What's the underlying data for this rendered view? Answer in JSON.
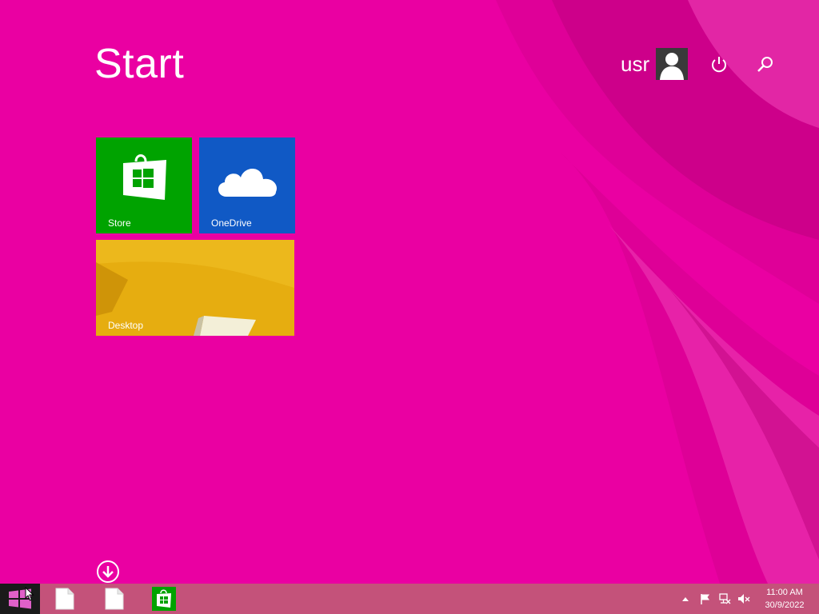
{
  "start": {
    "title": "Start"
  },
  "user": {
    "name": "usr"
  },
  "tiles": [
    {
      "label": "Store",
      "color": "#00a300",
      "icon": "store-bag-icon"
    },
    {
      "label": "OneDrive",
      "color": "#1059c5",
      "icon": "cloud-icon"
    },
    {
      "label": "Desktop",
      "color": "#e6ad10",
      "icon": "desktop-wallpaper"
    }
  ],
  "taskbar": {
    "items": [
      {
        "name": "start-button",
        "icon": "windows-logo-icon"
      },
      {
        "name": "document-1",
        "icon": "document-icon"
      },
      {
        "name": "document-2",
        "icon": "document-icon"
      },
      {
        "name": "store-app",
        "icon": "store-bag-icon"
      }
    ],
    "tray": [
      "show-hidden-icons-arrow",
      "action-center-flag-icon",
      "network-icon",
      "volume-muted-icon"
    ],
    "time": "11:00 AM",
    "date": "30/9/2022"
  },
  "colors": {
    "background": "#ea00a2",
    "taskbar": "#c4527a",
    "accent_dark": "#c8007f"
  }
}
